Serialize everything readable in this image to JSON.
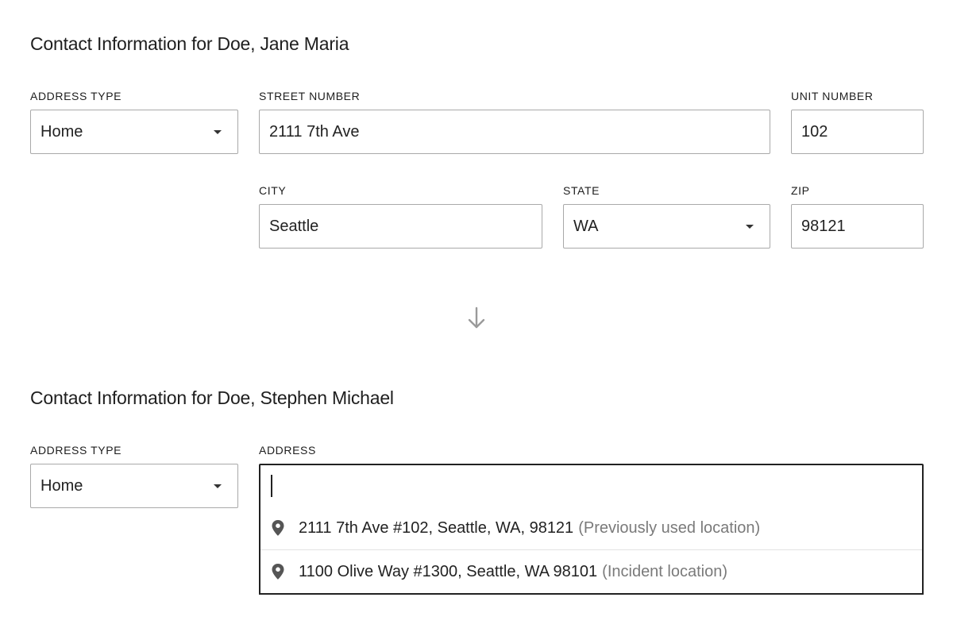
{
  "section1": {
    "title": "Contact Information for Doe, Jane Maria",
    "address_type": {
      "label": "ADDRESS TYPE",
      "value": "Home"
    },
    "street_number": {
      "label": "STREET NUMBER",
      "value": "2111 7th Ave"
    },
    "unit_number": {
      "label": "UNIT NUMBER",
      "value": "102"
    },
    "city": {
      "label": "CITY",
      "value": "Seattle"
    },
    "state": {
      "label": "STATE",
      "value": "WA"
    },
    "zip": {
      "label": "ZIP",
      "value": "98121"
    }
  },
  "divider": {
    "icon": "arrow-down-icon"
  },
  "section2": {
    "title": "Contact Information for Doe, Stephen Michael",
    "address_type": {
      "label": "ADDRESS TYPE",
      "value": "Home"
    },
    "address": {
      "label": "ADDRESS",
      "value": "",
      "suggestions": [
        {
          "icon": "location-pin-icon",
          "text": "2111 7th Ave #102, Seattle, WA, 98121",
          "note": "(Previously used location)"
        },
        {
          "icon": "location-pin-icon",
          "text": "1100 Olive Way #1300, Seattle, WA 98101",
          "note": "(Incident location)"
        }
      ]
    }
  },
  "colors": {
    "text": "#222222",
    "border": "#a9a9a9",
    "focus_border": "#222222",
    "muted_text": "#7a7a7a",
    "icon": "#555555"
  }
}
